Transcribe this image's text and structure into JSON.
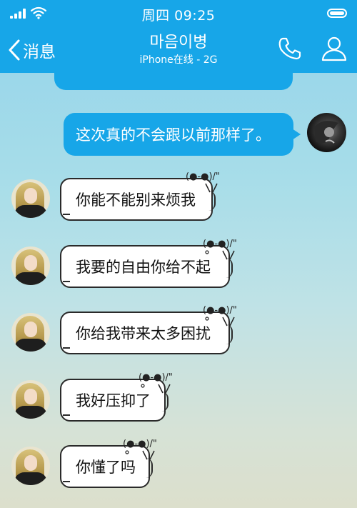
{
  "status_bar": {
    "time": "周四 09:25"
  },
  "nav": {
    "back_label": "消息",
    "title": "마음이병",
    "subtitle": "iPhone在线 - 2G"
  },
  "messages": [
    {
      "side": "mine",
      "text": "这次真的不会跟以前那样了。"
    },
    {
      "side": "theirs",
      "text": "你能不能别来烦我"
    },
    {
      "side": "theirs",
      "text": "我要的自由你给不起"
    },
    {
      "side": "theirs",
      "text": "你给我带来太多困扰"
    },
    {
      "side": "theirs",
      "text": "我好压抑了"
    },
    {
      "side": "theirs",
      "text": "你懂了吗"
    }
  ],
  "colors": {
    "accent": "#17a6e8",
    "bubble_border": "#2a2a2a"
  },
  "icons": {
    "back": "chevron-left-icon",
    "phone": "phone-icon",
    "profile": "person-icon",
    "signal": "signal-icon",
    "wifi": "wifi-icon",
    "battery": "battery-icon",
    "bubble_decoration": "baymax-icon"
  }
}
